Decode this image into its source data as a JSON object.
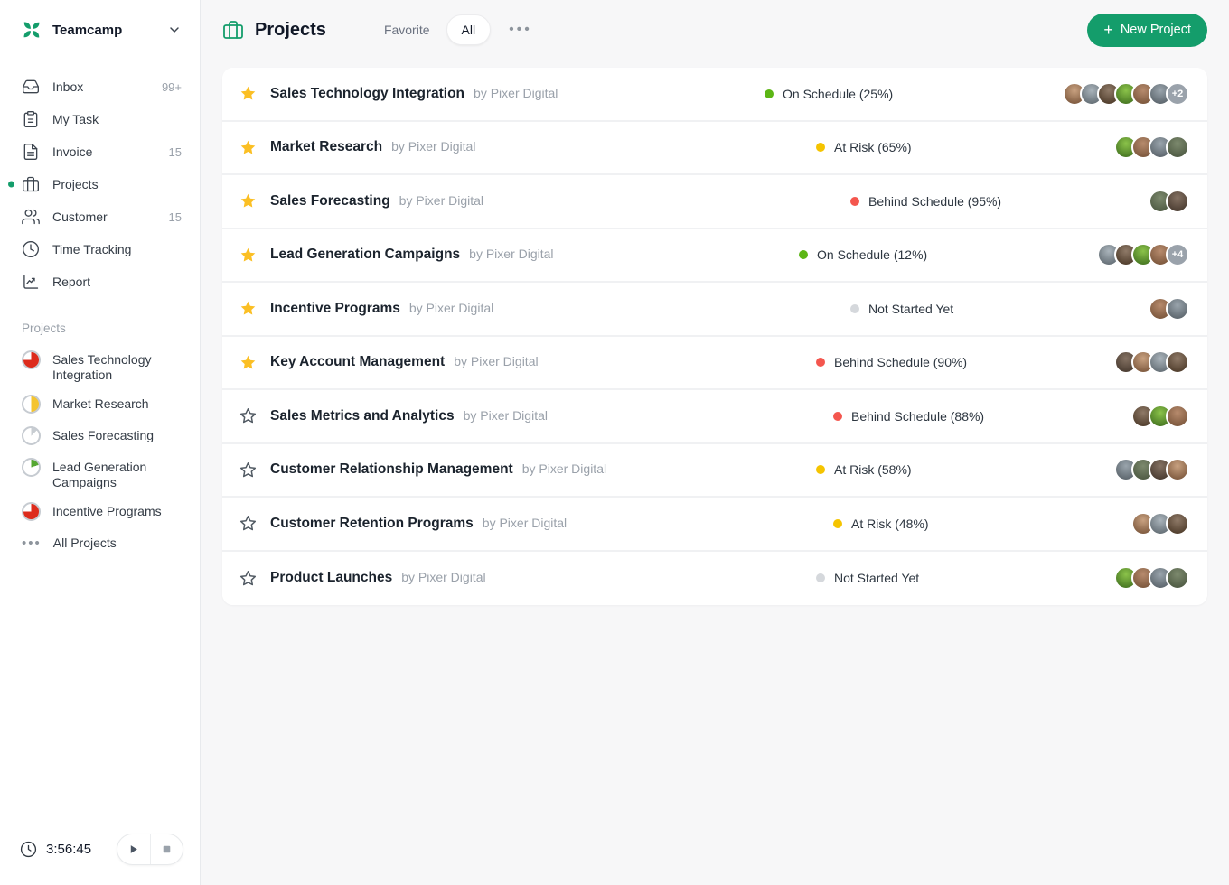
{
  "app": {
    "name": "Teamcamp"
  },
  "colors": {
    "accent": "#149d6b",
    "star": "#fbbf24",
    "status_green": "#5cb615",
    "status_yellow": "#f5c400",
    "status_red": "#f4564e",
    "status_gray": "#d5d8dc",
    "overflow_badge": "#9aa2ab"
  },
  "sidebar": {
    "nav": [
      {
        "label": "Inbox",
        "badge": "99+",
        "icon": "inbox-icon"
      },
      {
        "label": "My Task",
        "badge": "",
        "icon": "task-icon"
      },
      {
        "label": "Invoice",
        "badge": "15",
        "icon": "invoice-icon"
      },
      {
        "label": "Projects",
        "badge": "",
        "icon": "briefcase-icon",
        "active": true
      },
      {
        "label": "Customer",
        "badge": "15",
        "icon": "customer-icon"
      },
      {
        "label": "Time Tracking",
        "badge": "",
        "icon": "clock-icon"
      },
      {
        "label": "Report",
        "badge": "",
        "icon": "report-icon"
      }
    ],
    "projects_section": {
      "heading": "Projects",
      "items": [
        {
          "label": "Sales Technology Integration",
          "pie": {
            "color": "#dd2b1c",
            "pct": 75
          }
        },
        {
          "label": "Market Research",
          "pie": {
            "color": "#f4c430",
            "pct": 50
          }
        },
        {
          "label": "Sales Forecasting",
          "pie": {
            "color": "#c8cdd2",
            "pct": 13
          }
        },
        {
          "label": "Lead Generation Campaigns",
          "pie": {
            "color": "#56a832",
            "pct": 20
          }
        },
        {
          "label": "Incentive Programs",
          "pie": {
            "color": "#dd2b1c",
            "pct": 75
          }
        }
      ],
      "all_projects_label": "All Projects"
    },
    "timer": {
      "time": "3:56:45"
    }
  },
  "header": {
    "title": "Projects",
    "tabs": [
      {
        "label": "Favorite",
        "active": false
      },
      {
        "label": "All",
        "active": true
      }
    ],
    "more_glyph": "•••",
    "new_project": {
      "plus_glyph": "+",
      "label": "New Project"
    }
  },
  "projects": {
    "avatar_palette": [
      [
        "#c9a281",
        "#6e4a30"
      ],
      [
        "#aab4bb",
        "#566067"
      ],
      [
        "#8f7a68",
        "#42301f"
      ],
      [
        "#8bc34a",
        "#38661a"
      ],
      [
        "#b78b6d",
        "#6f4c32"
      ],
      [
        "#9aa5ad",
        "#4f585f"
      ],
      [
        "#7d8a6e",
        "#44503a"
      ],
      [
        "#857263",
        "#3d3026"
      ]
    ],
    "rows": [
      {
        "title": "Sales Technology Integration",
        "by": "by Pixer Digital",
        "status": "On Schedule (25%)",
        "status_color": "#5cb615",
        "favorite": true,
        "avatars": 6,
        "extra": "+2"
      },
      {
        "title": "Market Research",
        "by": "by Pixer Digital",
        "status": "At Risk (65%)",
        "status_color": "#f5c400",
        "favorite": true,
        "avatars": 4,
        "extra": ""
      },
      {
        "title": "Sales Forecasting",
        "by": "by Pixer Digital",
        "status": "Behind Schedule (95%)",
        "status_color": "#f4564e",
        "favorite": true,
        "avatars": 2,
        "extra": ""
      },
      {
        "title": "Lead Generation Campaigns",
        "by": "by Pixer Digital",
        "status": "On Schedule (12%)",
        "status_color": "#5cb615",
        "favorite": true,
        "avatars": 4,
        "extra": "+4"
      },
      {
        "title": "Incentive Programs",
        "by": "by Pixer Digital",
        "status": "Not Started Yet",
        "status_color": "#d5d8dc",
        "favorite": true,
        "avatars": 2,
        "extra": ""
      },
      {
        "title": "Key Account Management",
        "by": "by Pixer Digital",
        "status": "Behind Schedule (90%)",
        "status_color": "#f4564e",
        "favorite": true,
        "avatars": 4,
        "extra": ""
      },
      {
        "title": "Sales Metrics and Analytics",
        "by": "by Pixer Digital",
        "status": "Behind Schedule (88%)",
        "status_color": "#f4564e",
        "favorite": false,
        "avatars": 3,
        "extra": ""
      },
      {
        "title": "Customer Relationship Management",
        "by": "by Pixer Digital",
        "status": "At Risk (58%)",
        "status_color": "#f5c400",
        "favorite": false,
        "avatars": 4,
        "extra": ""
      },
      {
        "title": "Customer Retention Programs",
        "by": "by Pixer Digital",
        "status": "At Risk (48%)",
        "status_color": "#f5c400",
        "favorite": false,
        "avatars": 3,
        "extra": ""
      },
      {
        "title": "Product Launches",
        "by": "by Pixer Digital",
        "status": "Not Started Yet",
        "status_color": "#d5d8dc",
        "favorite": false,
        "avatars": 4,
        "extra": ""
      }
    ]
  }
}
